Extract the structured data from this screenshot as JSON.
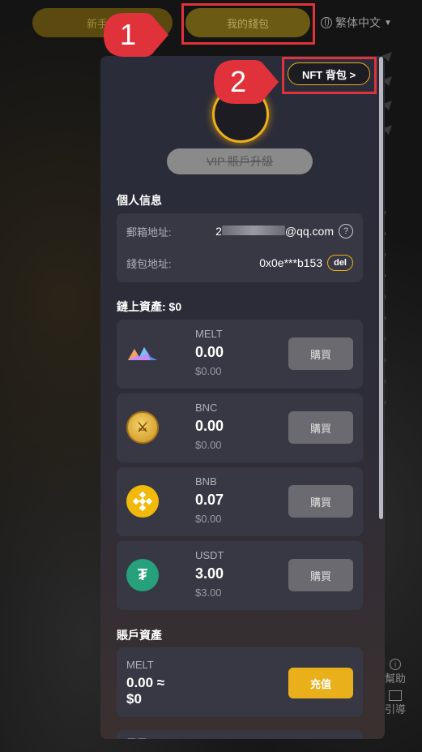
{
  "topbar": {
    "newbie_label": "新手…",
    "wallet_label": "我的錢包",
    "language": "繁体中文"
  },
  "annotations": {
    "marker1": "1",
    "marker2": "2"
  },
  "panel": {
    "nft_button": "NFT 背包 >",
    "vip_button": "VIP 賬戶升級",
    "personal_title": "個人信息",
    "email_label": "郵箱地址:",
    "email_prefix": "2",
    "email_suffix": "@qq.com",
    "wallet_label": "錢包地址:",
    "wallet_value": "0x0e***b153",
    "del_label": "del",
    "onchain_title": "鏈上資產: $0",
    "assets": [
      {
        "name": "MELT",
        "amount": "0.00",
        "usd": "$0.00",
        "buy": "購買",
        "icon": "melt-icon"
      },
      {
        "name": "BNC",
        "amount": "0.00",
        "usd": "$0.00",
        "buy": "購買",
        "icon": "bnc-icon"
      },
      {
        "name": "BNB",
        "amount": "0.07",
        "usd": "$0.00",
        "buy": "購買",
        "icon": "bnb-icon"
      },
      {
        "name": "USDT",
        "amount": "3.00",
        "usd": "$3.00",
        "buy": "購買",
        "icon": "usdt-icon"
      }
    ],
    "account_title": "賬戶資產",
    "account_asset": {
      "name": "MELT",
      "amount": "0.00 ≈",
      "usd": "$0",
      "charge": "充值"
    },
    "next_label": "雷電"
  },
  "side": {
    "help": "幫助",
    "guide": "引導"
  },
  "colors": {
    "accent": "#e9b01c",
    "highlight": "#e0323a",
    "card": "#383844"
  }
}
